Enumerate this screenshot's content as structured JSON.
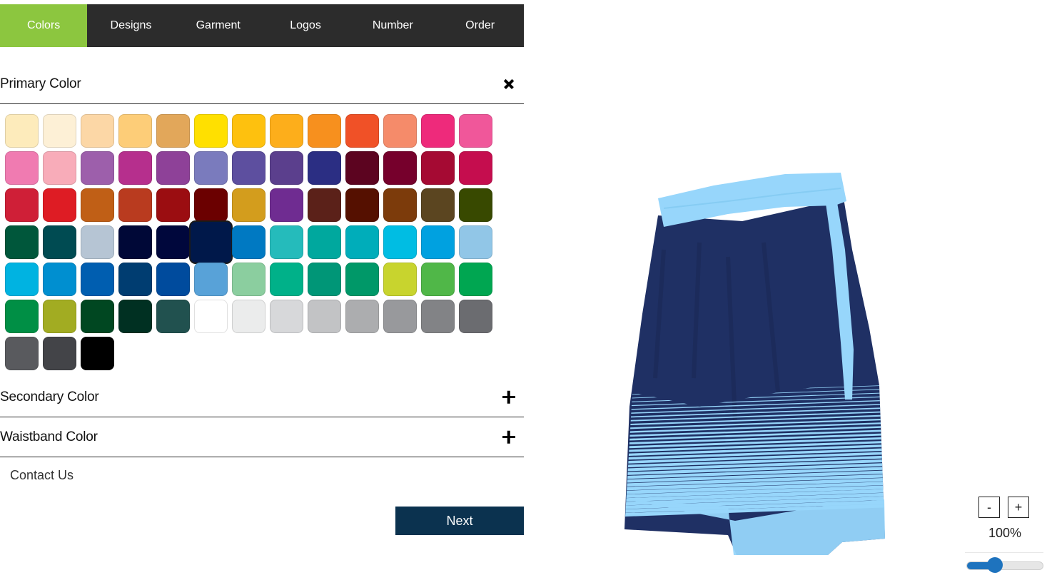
{
  "tabs": [
    {
      "label": "Colors",
      "active": true
    },
    {
      "label": "Designs",
      "active": false
    },
    {
      "label": "Garment",
      "active": false
    },
    {
      "label": "Logos",
      "active": false
    },
    {
      "label": "Number",
      "active": false
    },
    {
      "label": "Order",
      "active": false
    }
  ],
  "primary": {
    "title": "Primary Color",
    "icon": "close-icon"
  },
  "secondary": {
    "title": "Secondary Color",
    "icon": "plus-icon"
  },
  "waistband": {
    "title": "Waistband Color",
    "icon": "plus-icon"
  },
  "selected_swatch_index": 44,
  "swatches": [
    "#fdebbb",
    "#fdf0d6",
    "#fcd7a6",
    "#fdcd78",
    "#e2a75a",
    "#ffe000",
    "#fec10e",
    "#fdae1b",
    "#f7901e",
    "#f05127",
    "#f58b6a",
    "#ee2a7b",
    "#f0579a",
    "#f07bb1",
    "#f8acb9",
    "#9d5fab",
    "#b62f8d",
    "#8e4198",
    "#7a7bbd",
    "#5d4f9f",
    "#5b3f8d",
    "#2b2e83",
    "#5c0420",
    "#76002c",
    "#a50a33",
    "#c50d4e",
    "#cf1f37",
    "#de1c24",
    "#c05f16",
    "#b93b1f",
    "#9b0d11",
    "#6b0000",
    "#d39d1d",
    "#6f2c91",
    "#5b2119",
    "#551000",
    "#7c3b0b",
    "#5b4520",
    "#384900",
    "#00573b",
    "#004b52",
    "#b6c5d4",
    "#000837",
    "#00073c",
    "#00184a",
    "#0079c2",
    "#25bbbb",
    "#00a89e",
    "#00adba",
    "#00bde3",
    "#00a1e0",
    "#91c6e7",
    "#00b3e1",
    "#008fd0",
    "#005eb0",
    "#003d71",
    "#004b9d",
    "#58a2d8",
    "#8bce9f",
    "#00b189",
    "#009677",
    "#009868",
    "#c8d42e",
    "#50b748",
    "#00a651",
    "#008f45",
    "#a2ac22",
    "#004721",
    "#003022",
    "#21514f",
    "#ffffff",
    "#ebecec",
    "#d7d8da",
    "#c2c3c5",
    "#acadaf",
    "#98999c",
    "#828386",
    "#6b6c70",
    "#595a5e",
    "#434448",
    "#000000"
  ],
  "contact": {
    "label": "Contact Us"
  },
  "next": {
    "label": "Next"
  },
  "zoom": {
    "minus": "-",
    "plus": "+",
    "level": "100%",
    "value_fraction": 0.37
  },
  "garment": {
    "body_color": "#1f3064",
    "trim_color": "#97d6fb"
  }
}
